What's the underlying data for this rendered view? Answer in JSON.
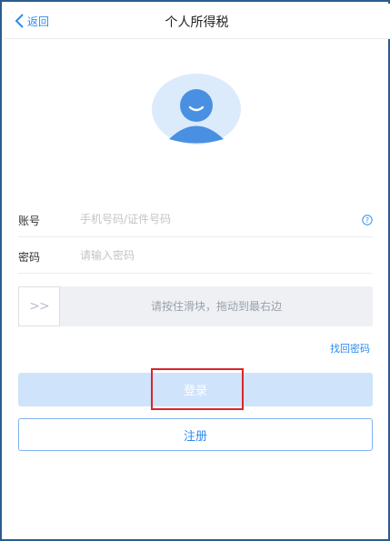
{
  "nav": {
    "back_label": "返回",
    "title": "个人所得税"
  },
  "form": {
    "account_label": "账号",
    "account_placeholder": "手机号码/证件号码",
    "password_label": "密码",
    "password_placeholder": "请输入密码"
  },
  "slider": {
    "handle_glyph": ">>",
    "hint": "请按住滑块，拖动到最右边"
  },
  "links": {
    "forgot_password": "找回密码"
  },
  "buttons": {
    "login": "登录",
    "register": "注册"
  },
  "icons": {
    "back": "chevron-left-icon",
    "avatar": "user-avatar-icon",
    "help": "question-circle-icon"
  },
  "colors": {
    "accent": "#2d8cf0",
    "login_bg_disabled": "#cfe3fb",
    "highlight_border": "#d9262a",
    "avatar_bg": "#dcebfb",
    "avatar_fg": "#4a90e2"
  }
}
